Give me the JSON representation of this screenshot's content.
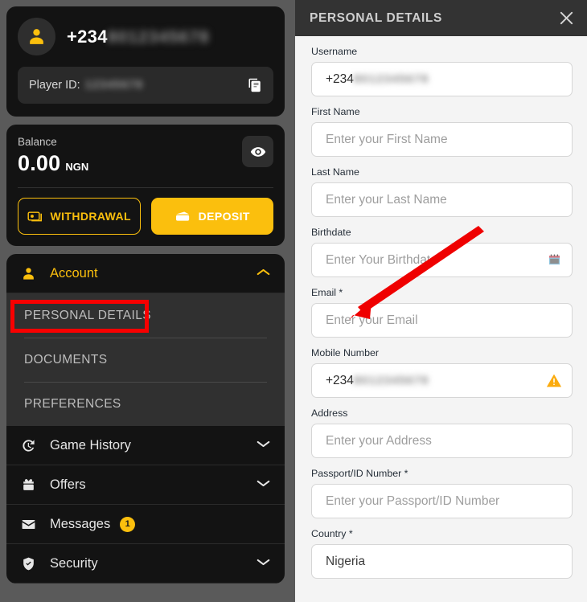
{
  "profile": {
    "phone_prefix": "+234",
    "phone_masked": "8012345678",
    "player_id_label": "Player ID:",
    "player_id_masked": "12345678",
    "avatar_icon": "user-icon",
    "copy_icon": "copy-icon"
  },
  "balance": {
    "label": "Balance",
    "amount": "0.00",
    "currency": "NGN",
    "eye_icon": "eye-icon",
    "withdrawal_label": "WITHDRAWAL",
    "deposit_label": "DEPOSIT",
    "withdrawal_icon": "money-icon",
    "deposit_icon": "wallet-icon"
  },
  "menu": {
    "account": {
      "label": "Account",
      "icon": "user-icon",
      "chevron": "chevron-up-icon",
      "expanded": true,
      "sub_items": [
        {
          "label": "PERSONAL DETAILS",
          "highlighted": true
        },
        {
          "label": "DOCUMENTS",
          "highlighted": false
        },
        {
          "label": "PREFERENCES",
          "highlighted": false
        }
      ]
    },
    "items": [
      {
        "label": "Game History",
        "icon": "history-icon",
        "chevron": "chevron-down-icon",
        "badge": null
      },
      {
        "label": "Offers",
        "icon": "gift-icon",
        "chevron": "chevron-down-icon",
        "badge": null
      },
      {
        "label": "Messages",
        "icon": "envelope-icon",
        "chevron": null,
        "badge": "1"
      },
      {
        "label": "Security",
        "icon": "shield-icon",
        "chevron": "chevron-down-icon",
        "badge": null
      }
    ]
  },
  "panel": {
    "title": "PERSONAL DETAILS",
    "close_icon": "close-icon",
    "fields": [
      {
        "label": "Username",
        "type": "masked",
        "value_prefix": "+234",
        "value_masked": "8012345678",
        "placeholder": "",
        "icon": null
      },
      {
        "label": "First Name",
        "type": "input",
        "value": "",
        "placeholder": "Enter your First Name",
        "icon": null
      },
      {
        "label": "Last Name",
        "type": "input",
        "value": "",
        "placeholder": "Enter your Last Name",
        "icon": null
      },
      {
        "label": "Birthdate",
        "type": "input",
        "value": "",
        "placeholder": "Enter Your Birthdate",
        "icon": "calendar-icon"
      },
      {
        "label": "Email *",
        "type": "input",
        "value": "",
        "placeholder": "Enter your Email",
        "icon": null
      },
      {
        "label": "Mobile Number",
        "type": "masked",
        "value_prefix": "+234",
        "value_masked": "8012345678",
        "placeholder": "",
        "icon": "warning-icon"
      },
      {
        "label": "Address",
        "type": "input",
        "value": "",
        "placeholder": "Enter your Address",
        "icon": null
      },
      {
        "label": "Passport/ID Number *",
        "type": "input",
        "value": "",
        "placeholder": "Enter your Passport/ID Number",
        "icon": null
      },
      {
        "label": "Country *",
        "type": "input",
        "value": "Nigeria",
        "placeholder": "",
        "icon": null
      }
    ]
  },
  "annotations": {
    "highlight_color": "#f90000",
    "arrow_color": "#ef0000",
    "accent_color": "#fbbf0d"
  }
}
